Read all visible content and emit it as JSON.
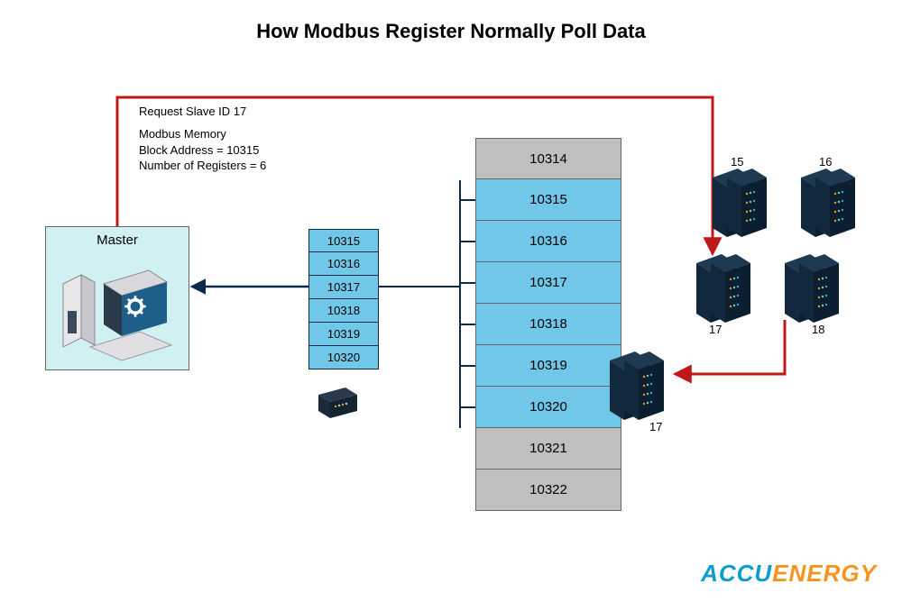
{
  "title": "How Modbus Register Normally Poll Data",
  "request_label": "Request Slave ID 17",
  "memory": {
    "heading": "Modbus Memory",
    "line1": "Block Address = 10315",
    "line2": "Number of Registers = 6"
  },
  "master_label": "Master",
  "response_registers": [
    "10315",
    "10316",
    "10317",
    "10318",
    "10319",
    "10320"
  ],
  "memory_map": [
    {
      "addr": "10314",
      "active": false
    },
    {
      "addr": "10315",
      "active": true
    },
    {
      "addr": "10316",
      "active": true
    },
    {
      "addr": "10317",
      "active": true
    },
    {
      "addr": "10318",
      "active": true
    },
    {
      "addr": "10319",
      "active": true
    },
    {
      "addr": "10320",
      "active": true
    },
    {
      "addr": "10321",
      "active": false
    },
    {
      "addr": "10322",
      "active": false
    }
  ],
  "slaves": {
    "top_left": "15",
    "top_right": "16",
    "mid_left": "17",
    "mid_right": "18",
    "selected": "17"
  },
  "logo_a": "ACCU",
  "logo_b": "ENERGY"
}
